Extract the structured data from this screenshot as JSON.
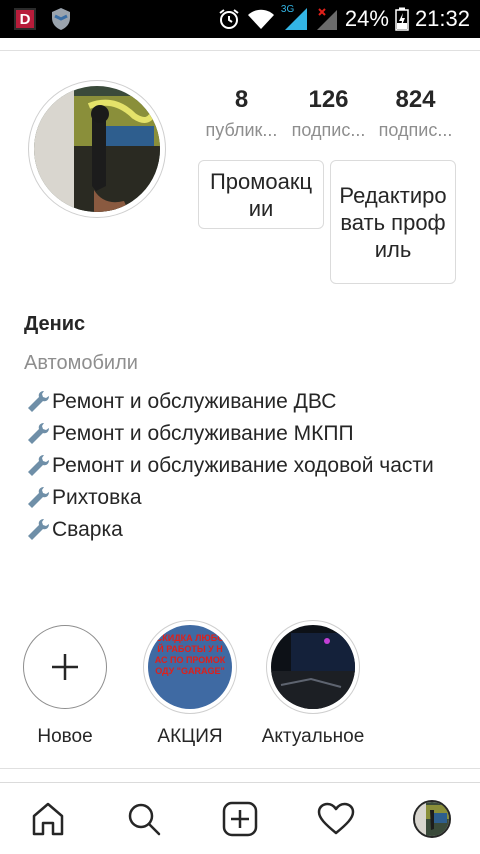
{
  "status_bar": {
    "app_badge": "D",
    "network": "3G",
    "battery": "24%",
    "time": "21:32"
  },
  "profile": {
    "stats": [
      {
        "count": "8",
        "label": "публик..."
      },
      {
        "count": "126",
        "label": "подпис..."
      },
      {
        "count": "824",
        "label": "подпис..."
      }
    ],
    "promo_button": "Промоакции",
    "edit_button": "Редактировать профиль",
    "name": "Денис",
    "category": "Автомобили",
    "bio": [
      "Ремонт и обслуживание ДВС",
      "Ремонт и обслуживание МКПП",
      "Ремонт и обслуживание ходовой части",
      "Рихтовка",
      "Сварка"
    ]
  },
  "highlights": [
    {
      "label": "Новое",
      "kind": "new",
      "icon": "plus-icon"
    },
    {
      "label": "АКЦИЯ",
      "kind": "story",
      "overlay_text": "СКИДКА ЛЮБОЙ РАБОТЫ У НАС ПО ПРОМОКОДУ \"GARAGE\""
    },
    {
      "label": "Актуальное",
      "kind": "story"
    }
  ],
  "bottom_nav": [
    {
      "icon": "home-icon"
    },
    {
      "icon": "search-icon"
    },
    {
      "icon": "add-post-icon"
    },
    {
      "icon": "heart-icon"
    },
    {
      "icon": "profile-avatar-icon"
    }
  ],
  "colors": {
    "text": "#262626",
    "secondary_text": "#8e8e8e",
    "border": "#dbdbdb",
    "accent_red": "#e0201a"
  }
}
